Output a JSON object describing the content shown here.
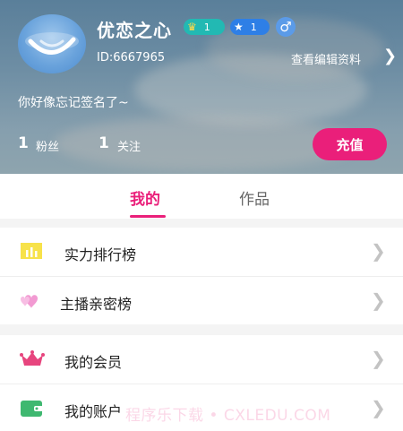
{
  "profile": {
    "username": "优恋之心",
    "badge_level_1": "1",
    "badge_level_2": "1",
    "gender_symbol": "♂",
    "user_id": "ID:6667965",
    "edit_profile": "查看编辑资料",
    "signature": "你好像忘记签名了~"
  },
  "stats": {
    "fans_count": "1",
    "fans_label": "粉丝",
    "following_count": "1",
    "following_label": "关注"
  },
  "recharge_label": "充值",
  "tabs": [
    {
      "label": "我的",
      "active": true
    },
    {
      "label": "作品",
      "active": false
    }
  ],
  "menu_group_1": [
    {
      "label": "实力排行榜",
      "icon": "ranking-chart-icon"
    },
    {
      "label": "主播亲密榜",
      "icon": "hearts-icon"
    }
  ],
  "menu_group_2": [
    {
      "label": "我的会员",
      "icon": "crown-icon"
    },
    {
      "label": "我的账户",
      "icon": "wallet-icon"
    }
  ],
  "watermark": "程序乐下载 • CXLEDU.COM",
  "colors": {
    "accent": "#ea1f7a",
    "badge_teal": "#22b9b3",
    "badge_blue": "#2e7fe6",
    "rank_icon": "#f7e24a",
    "heart_icon": "#f29ad2",
    "crown_icon": "#e7457e",
    "wallet_icon": "#3fb870"
  }
}
